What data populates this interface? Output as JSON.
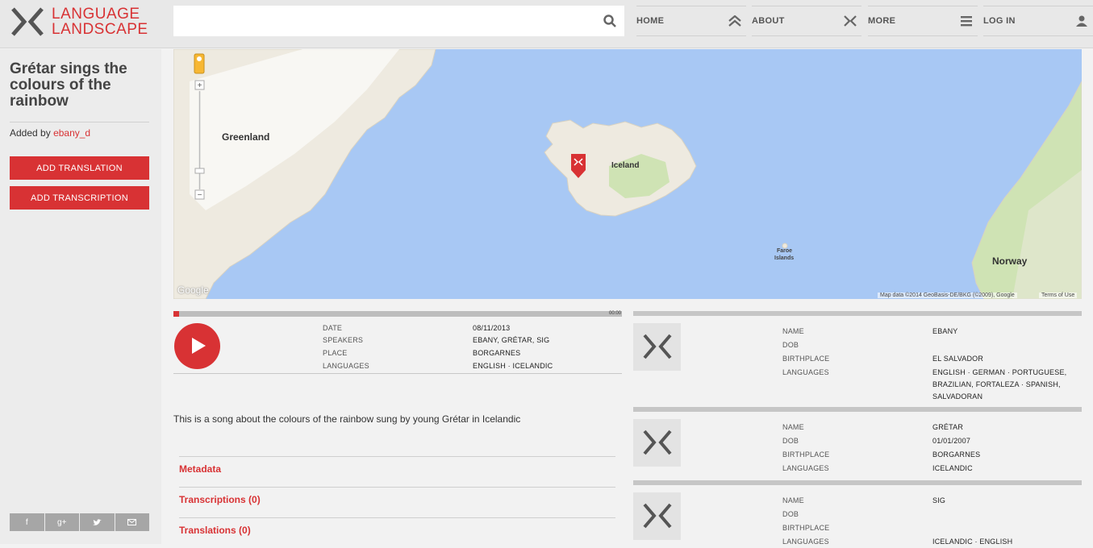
{
  "header": {
    "logo_line1": "LANGUAGE",
    "logo_line2": "LANDSCAPE",
    "search_placeholder": "",
    "nav": [
      {
        "label": "HOME",
        "icon": "home-icon"
      },
      {
        "label": "ABOUT",
        "icon": "logo-mark-icon"
      },
      {
        "label": "MORE",
        "icon": "menu-icon"
      },
      {
        "label": "LOG IN",
        "icon": "user-icon"
      }
    ]
  },
  "sidebar": {
    "title": "Grétar sings the colours of the rainbow",
    "added_by_prefix": "Added by",
    "added_by_user": "ebany_d",
    "add_translation": "ADD TRANSLATION",
    "add_transcription": "ADD TRANSCRIPTION",
    "share": [
      "f",
      "g+",
      "twitter",
      "email"
    ]
  },
  "map": {
    "labels": {
      "greenland": "Greenland",
      "iceland": "Iceland",
      "faroe1": "Faroe",
      "faroe2": "Islands",
      "norway": "Norway",
      "google": "Google",
      "attribution": "Map data ©2014 GeoBasis-DE/BKG (©2009), Google",
      "terms": "Terms of Use"
    },
    "colors": {
      "water": "#a8c8f4",
      "land": "#eeeae0",
      "green": "#cfe3b4",
      "marker": "#d83234"
    }
  },
  "player": {
    "time": "00:00",
    "progress": 0,
    "meta": [
      {
        "label": "DATE",
        "value": "08/11/2013"
      },
      {
        "label": "SPEAKERS",
        "value": "EBANY, GRÉTAR, SIG"
      },
      {
        "label": "PLACE",
        "value": "BORGARNES"
      },
      {
        "label": "LANGUAGES",
        "value": "ENGLISH · ICELANDIC"
      }
    ]
  },
  "description": "This is a song about the colours of the rainbow sung by young Grétar in Icelandic",
  "sections": [
    "Metadata",
    "Transcriptions (0)",
    "Translations (0)"
  ],
  "speakers": [
    {
      "labels": [
        "NAME",
        "DOB",
        "BIRTHPLACE",
        "LANGUAGES"
      ],
      "name": "EBANY",
      "dob": "",
      "birthplace": "EL SALVADOR",
      "languages": "ENGLISH · GERMAN · PORTUGUESE, BRAZILIAN, FORTALEZA · SPANISH, SALVADORAN"
    },
    {
      "labels": [
        "NAME",
        "DOB",
        "BIRTHPLACE",
        "LANGUAGES"
      ],
      "name": "GRÉTAR",
      "dob": "01/01/2007",
      "birthplace": "BORGARNES",
      "languages": "ICELANDIC"
    },
    {
      "labels": [
        "NAME",
        "DOB",
        "BIRTHPLACE",
        "LANGUAGES"
      ],
      "name": "SIG",
      "dob": "",
      "birthplace": "",
      "languages": "ICELANDIC · ENGLISH"
    }
  ]
}
